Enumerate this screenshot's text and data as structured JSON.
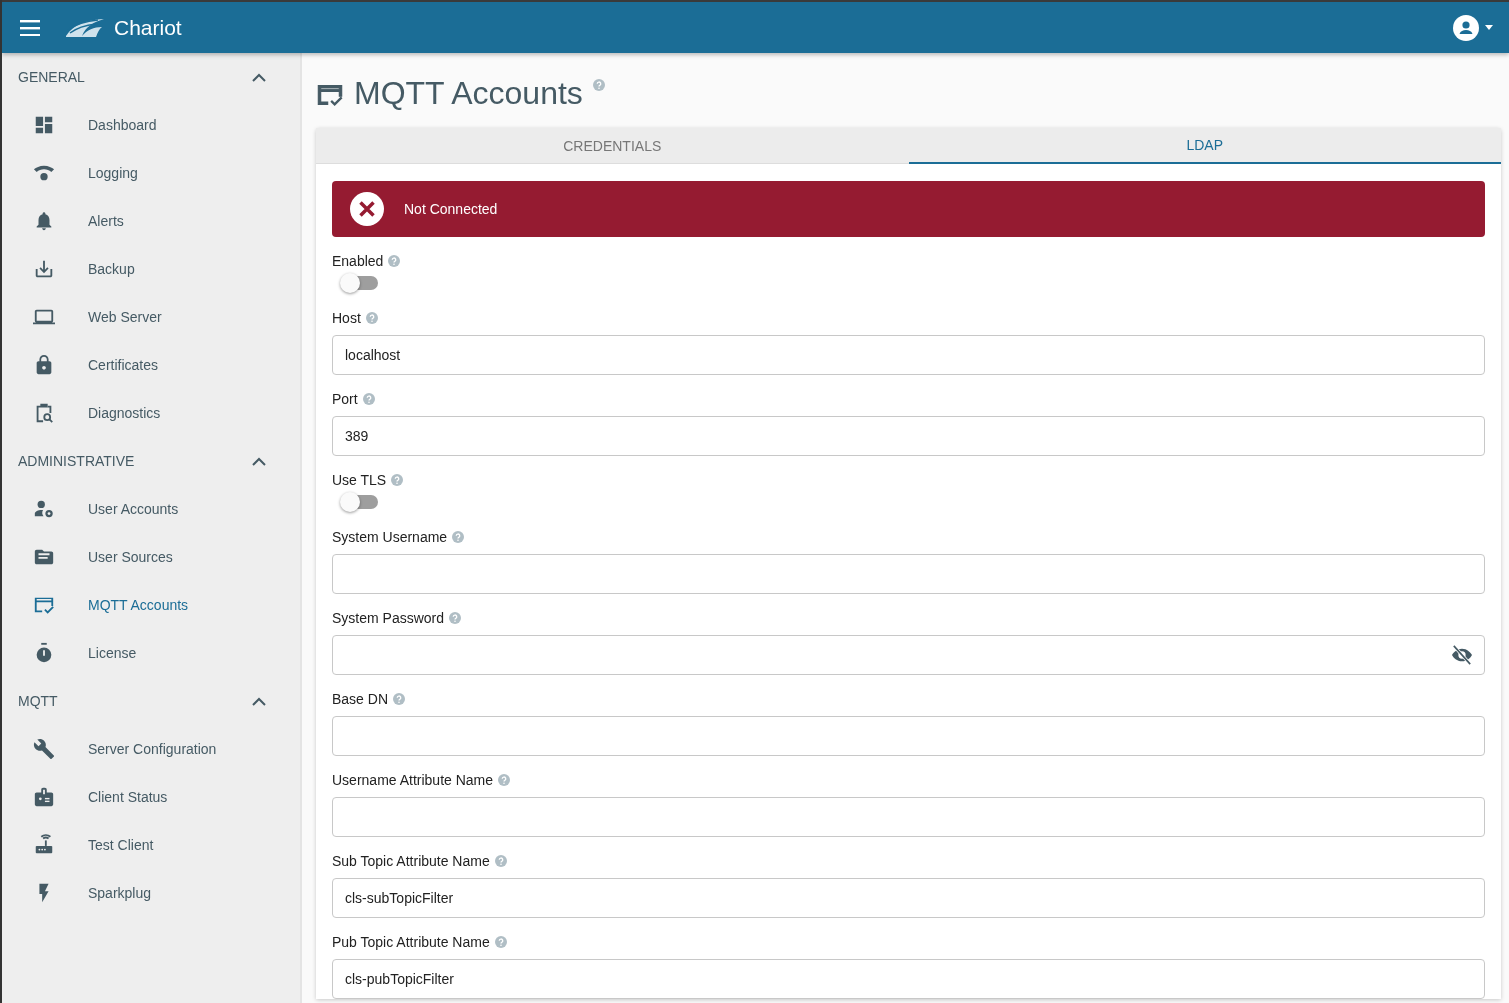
{
  "app_bar": {
    "brand": "Chariot"
  },
  "sidebar": {
    "sections": [
      {
        "title": "GENERAL",
        "expanded": true,
        "items": [
          {
            "label": "Dashboard",
            "selected": false
          },
          {
            "label": "Logging",
            "selected": false
          },
          {
            "label": "Alerts",
            "selected": false
          },
          {
            "label": "Backup",
            "selected": false
          },
          {
            "label": "Web Server",
            "selected": false
          },
          {
            "label": "Certificates",
            "selected": false
          },
          {
            "label": "Diagnostics",
            "selected": false
          }
        ]
      },
      {
        "title": "ADMINISTRATIVE",
        "expanded": true,
        "items": [
          {
            "label": "User Accounts",
            "selected": false
          },
          {
            "label": "User Sources",
            "selected": false
          },
          {
            "label": "MQTT Accounts",
            "selected": true
          },
          {
            "label": "License",
            "selected": false
          }
        ]
      },
      {
        "title": "MQTT",
        "expanded": true,
        "items": [
          {
            "label": "Server Configuration",
            "selected": false
          },
          {
            "label": "Client Status",
            "selected": false
          },
          {
            "label": "Test Client",
            "selected": false
          },
          {
            "label": "Sparkplug",
            "selected": false
          }
        ]
      }
    ]
  },
  "page": {
    "title": "MQTT Accounts"
  },
  "tabs": [
    {
      "label": "CREDENTIALS",
      "selected": false
    },
    {
      "label": "LDAP",
      "selected": true
    }
  ],
  "status_banner": {
    "text": "Not Connected",
    "connected": false
  },
  "fields": [
    {
      "kind": "toggle",
      "label": "Enabled",
      "on": false
    },
    {
      "kind": "text",
      "label": "Host",
      "value": "localhost"
    },
    {
      "kind": "text",
      "label": "Port",
      "value": "389"
    },
    {
      "kind": "toggle",
      "label": "Use TLS",
      "on": false
    },
    {
      "kind": "text",
      "label": "System Username"
    },
    {
      "kind": "password",
      "label": "System Password"
    },
    {
      "kind": "text",
      "label": "Base DN"
    },
    {
      "kind": "text",
      "label": "Username Attribute Name"
    },
    {
      "kind": "text",
      "label": "Sub Topic Attribute Name",
      "value": "cls-subTopicFilter"
    },
    {
      "kind": "text",
      "label": "Pub Topic Attribute Name",
      "value": "cls-pubTopicFilter"
    }
  ]
}
